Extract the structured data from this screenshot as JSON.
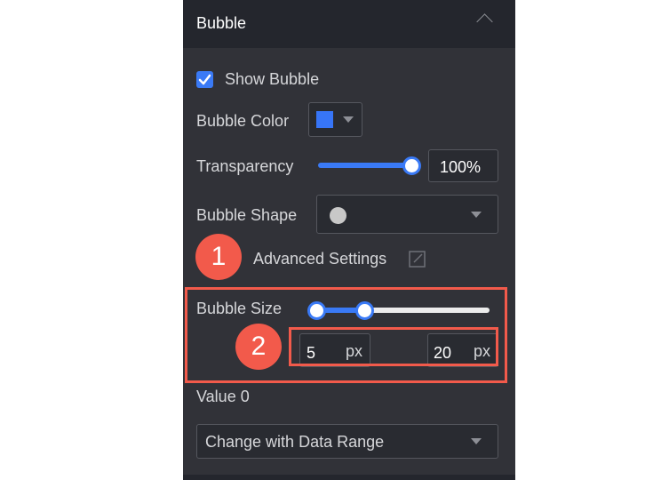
{
  "panel": {
    "title": "Bubble",
    "collapse_icon": "chevron-up-icon"
  },
  "show_bubble": {
    "label": "Show Bubble",
    "checked": true
  },
  "bubble_color": {
    "label": "Bubble Color",
    "value": "#3775f7"
  },
  "transparency": {
    "label": "Transparency",
    "value_percent": 100,
    "display": "100%"
  },
  "bubble_shape": {
    "label": "Bubble Shape",
    "selected_shape": "circle"
  },
  "advanced_settings": {
    "label": "Advanced Settings",
    "icon": "edit-icon"
  },
  "bubble_size": {
    "label": "Bubble Size",
    "min_value": "5",
    "max_value": "20",
    "unit": "px",
    "slider_low_fraction": 0.0,
    "slider_high_fraction": 0.27
  },
  "value_section": {
    "label": "Value 0",
    "dropdown_value": "Change with Data Range"
  },
  "annotations": [
    {
      "number": "1",
      "color": "#f25a4b"
    },
    {
      "number": "2",
      "color": "#f25a4b"
    }
  ]
}
